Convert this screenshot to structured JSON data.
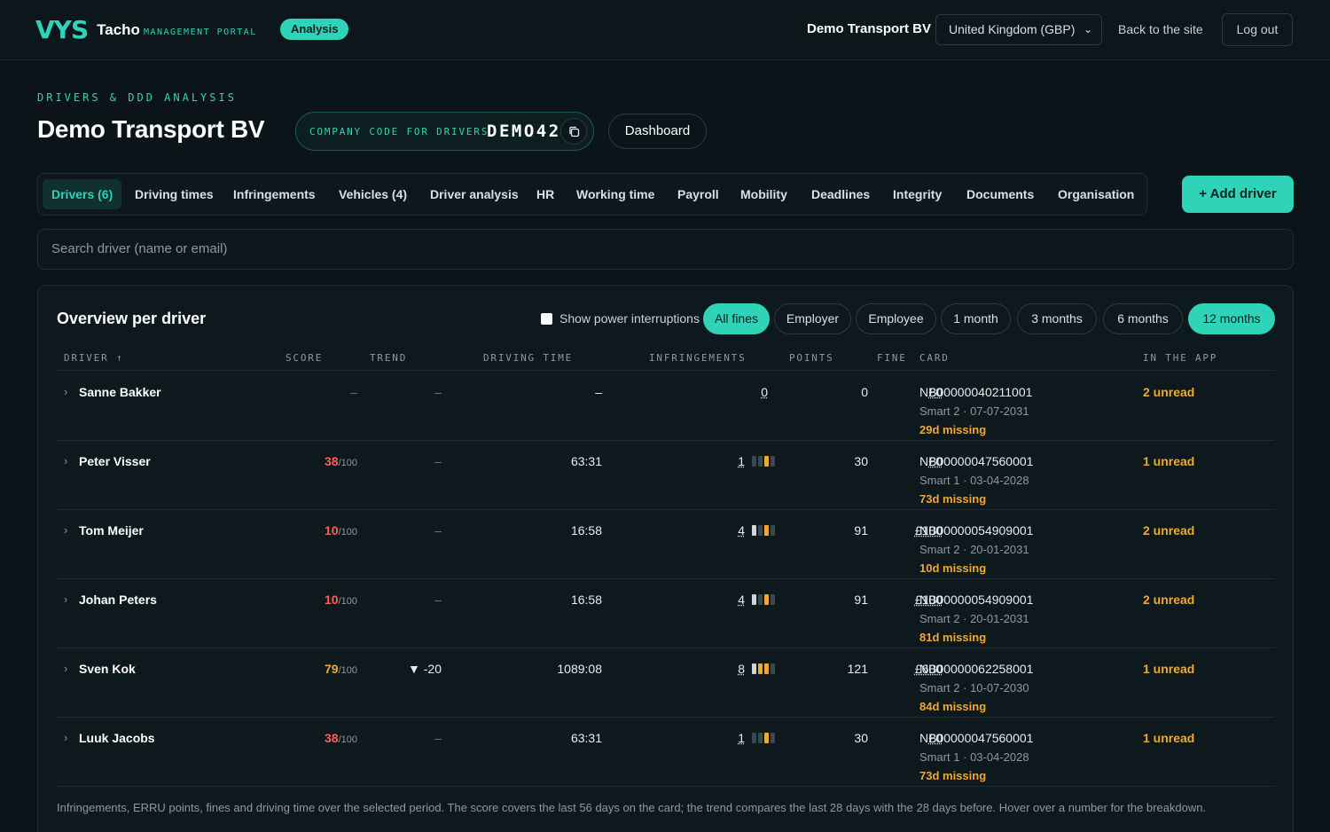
{
  "header": {
    "logo_mark_v": "V",
    "logo_mark_ys": "YS",
    "logo_name": "Tacho",
    "logo_sub": "MANAGEMENT PORTAL",
    "badge": "Analysis",
    "company": "Demo Transport BV",
    "region_select": "United Kingdom (GBP)",
    "back_link": "Back to the site",
    "logout": "Log out"
  },
  "page": {
    "eyebrow": "DRIVERS & DDD ANALYSIS",
    "title": "Demo Transport BV",
    "code_label": "COMPANY CODE FOR DRIVERS",
    "code_value": "DEMO42",
    "dashboard_button": "Dashboard"
  },
  "tabs": [
    "Drivers (6)",
    "Driving times",
    "Infringements",
    "Vehicles (4)",
    "Driver analysis",
    "HR",
    "Working time",
    "Payroll",
    "Mobility",
    "Deadlines",
    "Integrity",
    "Documents",
    "Organisation"
  ],
  "add_driver": "+ Add driver",
  "search_placeholder": "Search driver (name or email)",
  "panel": {
    "title": "Overview per driver",
    "checkbox_label": "Show power interruptions",
    "filters": [
      "All fines",
      "Employer",
      "Employee",
      "1 month",
      "3 months",
      "6 months",
      "12 months"
    ],
    "active_filters": [
      "All fines",
      "12 months"
    ],
    "columns": {
      "driver": "DRIVER ↑",
      "score": "SCORE",
      "trend": "TREND",
      "driving_time": "DRIVING TIME",
      "infringements": "INFRINGEMENTS",
      "points": "POINTS",
      "fine": "FINE",
      "card": "CARD",
      "in_app": "IN THE APP"
    },
    "footnote": "Infringements, ERRU points, fines and driving time over the selected period. The score covers the last 56 days on the card; the trend compares the last 28 days with the 28 days before. Hover over a number for the breakdown."
  },
  "drivers": [
    {
      "name": "Sanne Bakker",
      "score": "–",
      "score_den": "",
      "trend": "–",
      "driving_time": "–",
      "infringements": "0",
      "points": "0",
      "fine": "£0",
      "card": "NB00000040211001",
      "card_sub": "Smart 2 · 07-07-2031",
      "card_missing": "29d missing",
      "in_app": "2 unread",
      "bars": []
    },
    {
      "name": "Peter Visser",
      "score": "38",
      "score_den": "/100",
      "trend": "–",
      "driving_time": "63:31",
      "infringements": "1",
      "points": "30",
      "fine": "£0",
      "card": "NB00000047560001",
      "card_sub": "Smart 1 · 03-04-2028",
      "card_missing": "73d missing",
      "in_app": "1 unread",
      "bars": [
        "#3a4850",
        "#3a4850",
        "#f0a830",
        "#3a4850"
      ]
    },
    {
      "name": "Tom Meijer",
      "score": "10",
      "score_den": "/100",
      "trend": "–",
      "driving_time": "16:58",
      "infringements": "4",
      "points": "91",
      "fine": "£100",
      "card": "NB00000054909001",
      "card_sub": "Smart 2 · 20-01-2031",
      "card_missing": "10d missing",
      "in_app": "2 unread",
      "bars": [
        "#cfd6da",
        "#3a4850",
        "#f0a830",
        "#3a4850"
      ]
    },
    {
      "name": "Johan Peters",
      "score": "10",
      "score_den": "/100",
      "trend": "–",
      "driving_time": "16:58",
      "infringements": "4",
      "points": "91",
      "fine": "£100",
      "card": "NB00000054909001",
      "card_sub": "Smart 2 · 20-01-2031",
      "card_missing": "81d missing",
      "in_app": "2 unread",
      "bars": [
        "#cfd6da",
        "#3a4850",
        "#f0a830",
        "#3a4850"
      ]
    },
    {
      "name": "Sven Kok",
      "score": "79",
      "score_den": "/100",
      "trend": "▼ -20",
      "driving_time": "1089:08",
      "infringements": "8",
      "points": "121",
      "fine": "£600",
      "card": "NB00000062258001",
      "card_sub": "Smart 2 · 10-07-2030",
      "card_missing": "84d missing",
      "in_app": "1 unread",
      "bars": [
        "#cfd6da",
        "#f0a830",
        "#f0a830",
        "#3a4850"
      ]
    },
    {
      "name": "Luuk Jacobs",
      "score": "38",
      "score_den": "/100",
      "trend": "–",
      "driving_time": "63:31",
      "infringements": "1",
      "points": "30",
      "fine": "£0",
      "card": "NB00000047560001",
      "card_sub": "Smart 1 · 03-04-2028",
      "card_missing": "73d missing",
      "in_app": "1 unread",
      "bars": [
        "#3a4850",
        "#3a4850",
        "#f0a830",
        "#3a4850"
      ]
    }
  ],
  "colors": {
    "accent": "#2fd3b8",
    "danger": "#ff5f56",
    "warning": "#f0a830"
  }
}
